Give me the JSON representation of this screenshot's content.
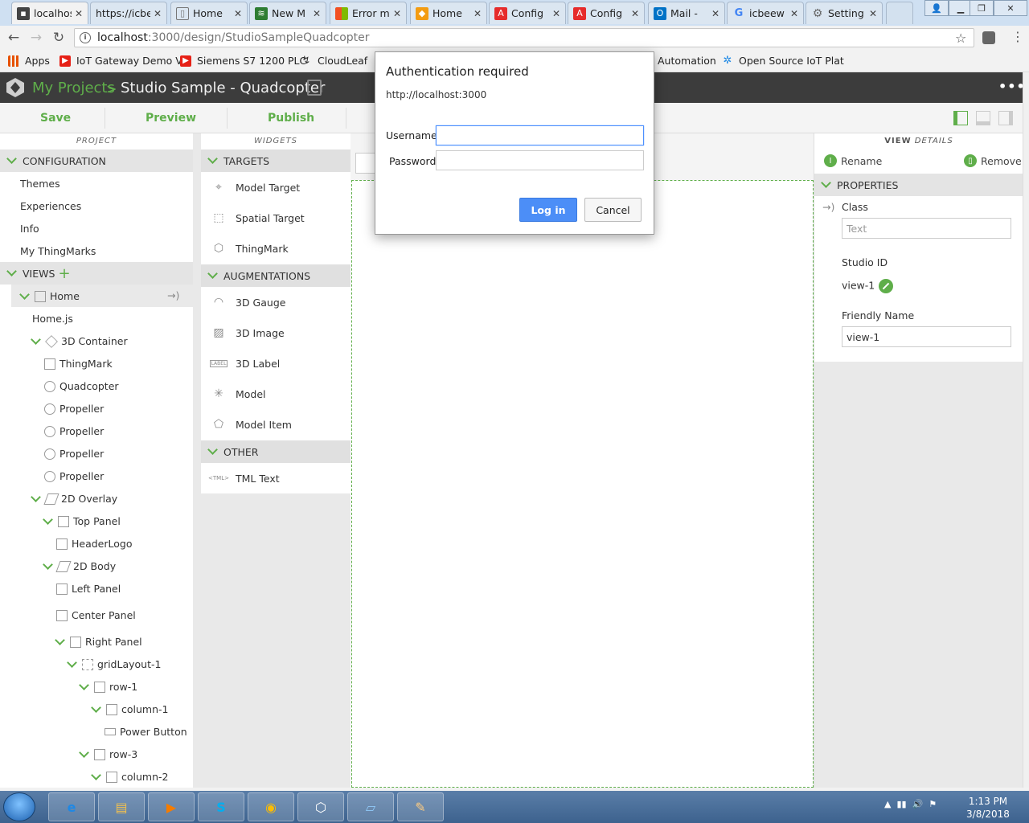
{
  "browser": {
    "tabs": [
      {
        "label": "localhost",
        "icon": "page-icon",
        "color": "#444444"
      },
      {
        "label": "https://icbe",
        "icon": "page-icon",
        "color": "#777777"
      },
      {
        "label": "Home",
        "icon": "page-icon",
        "color": "#777777"
      },
      {
        "label": "New M",
        "icon": "layers-icon",
        "color": "#2e7d32"
      },
      {
        "label": "Error m",
        "icon": "windows-icon",
        "color": "#f25022"
      },
      {
        "label": "Home",
        "icon": "box-icon",
        "color": "#f39c12"
      },
      {
        "label": "Config",
        "icon": "adobe-icon",
        "color": "#e62b2b"
      },
      {
        "label": "Config",
        "icon": "adobe-icon",
        "color": "#e62b2b"
      },
      {
        "label": "Mail - ",
        "icon": "outlook-icon",
        "color": "#0072c6"
      },
      {
        "label": "icbeew",
        "icon": "google-icon",
        "color": "#4285f4"
      },
      {
        "label": "Setting",
        "icon": "gear-icon",
        "color": "#777777"
      }
    ],
    "url_host": "localhost",
    "url_path": ":3000/design/StudioSampleQuadcopter",
    "bookmarks": [
      {
        "label": "Apps",
        "color": "#e65100"
      },
      {
        "label": "IoT Gateway Demo V",
        "color": "#e62117"
      },
      {
        "label": "Siemens S7 1200 PLC",
        "color": "#e62117"
      },
      {
        "label": "CloudLeaf",
        "color": "#333333"
      },
      {
        "label": "Automation",
        "color": "#777777"
      },
      {
        "label": "Open Source IoT Plat",
        "color": "#1e88e5"
      }
    ]
  },
  "app": {
    "crumb_projects": "My Projects",
    "crumb_sep": ">",
    "crumb_title": "Studio Sample - Quadcopter",
    "more": "•••",
    "toolbar": {
      "save": "Save",
      "preview": "Preview",
      "publish": "Publish"
    },
    "accent": "#5fae4a"
  },
  "project_panel": {
    "header": "PROJECT",
    "configuration": "CONFIGURATION",
    "config_items": [
      "Themes",
      "Experiences",
      "Info",
      "My ThingMarks"
    ],
    "views": "VIEWS",
    "views_add": "+",
    "home": "Home",
    "tree": [
      "Home.js",
      "3D Container",
      "ThingMark",
      "Quadcopter",
      "Propeller",
      "Propeller",
      "Propeller",
      "Propeller",
      "2D Overlay",
      "Top Panel",
      "HeaderLogo",
      "2D Body",
      "Left Panel",
      "Center Panel",
      "Right Panel",
      "gridLayout-1",
      "row-1",
      "column-1",
      "Power Button",
      "row-3",
      "column-2"
    ]
  },
  "widgets_panel": {
    "header": "WIDGETS",
    "targets": "TARGETS",
    "target_items": [
      "Model Target",
      "Spatial Target",
      "ThingMark"
    ],
    "augmentations": "AUGMENTATIONS",
    "augmentation_items": [
      "3D Gauge",
      "3D Image",
      "3D Label",
      "Model",
      "Model Item"
    ],
    "other": "OTHER",
    "other_items": [
      "TML Text"
    ],
    "label_badge": "LABEL",
    "tml_badge": "<TML>"
  },
  "details_panel": {
    "header_bold": "VIEW",
    "header_rest": " DETAILS",
    "rename": "Rename",
    "remove": "Remove",
    "properties": "PROPERTIES",
    "class_label": "Class",
    "class_placeholder": "Text",
    "studio_id_label": "Studio ID",
    "studio_id_value": "view-1",
    "friendly_name_label": "Friendly Name",
    "friendly_name_value": "view-1"
  },
  "dialog": {
    "title": "Authentication required",
    "url": "http://localhost:3000",
    "username_label": "Username",
    "username_value": "",
    "password_label": "Password",
    "password_value": "",
    "login": "Log in",
    "cancel": "Cancel",
    "login_color": "#4c8ef7"
  },
  "taskbar": {
    "items": [
      "ie-icon",
      "explorer-icon",
      "media-player-icon",
      "skype-icon",
      "chrome-icon",
      "vuforia-studio-icon",
      "notepad-icon",
      "paint-icon"
    ],
    "time": "1:13 PM",
    "date": "3/8/2018"
  }
}
